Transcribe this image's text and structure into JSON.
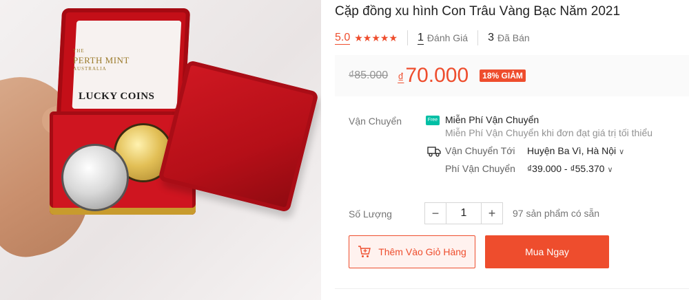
{
  "image": {
    "brand_line1": "THE",
    "brand_line2": "PERTH MINT",
    "brand_line3": "AUSTRALIA",
    "box_text": "LUCKY COINS"
  },
  "product": {
    "title": "Cặp đồng xu hình Con Trâu Vàng Bạc Năm 2021",
    "rating": "5.0",
    "stars": "★★★★★",
    "review_count": "1",
    "review_label": "Đánh Giá",
    "sold_count": "3",
    "sold_label": "Đã Bán"
  },
  "price": {
    "original": "₫85.000",
    "currency": "₫",
    "current": "70.000",
    "discount": "18% GIẢM"
  },
  "shipping": {
    "label": "Vận Chuyển",
    "free_icon_text": "Free",
    "free_title": "Miễn Phí Vận Chuyển",
    "free_subtitle": "Miễn Phí Vận Chuyển khi đơn đạt giá trị tối thiểu",
    "to_label": "Vận Chuyển Tới",
    "to_value": "Huyện Ba Vì, Hà Nội",
    "fee_label": "Phí Vận Chuyển",
    "fee_value": "₫39.000 - ₫55.370"
  },
  "quantity": {
    "label": "Số Lượng",
    "minus": "−",
    "value": "1",
    "plus": "+",
    "stock": "97 sản phẩm có sẵn"
  },
  "actions": {
    "add_to_cart": "Thêm Vào Giỏ Hàng",
    "buy_now": "Mua Ngay"
  },
  "colors": {
    "accent": "#ee4d2d",
    "free_ship": "#00bfa5"
  }
}
